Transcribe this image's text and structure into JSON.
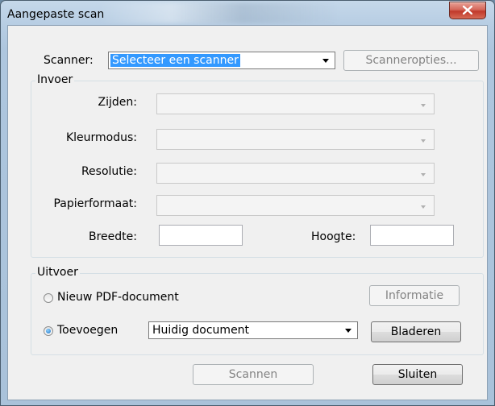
{
  "window": {
    "title": "Aangepaste scan",
    "close_icon": "close-icon"
  },
  "scanner": {
    "label": "Scanner:",
    "selected": "Selecteer een scanner",
    "options_button": "Scanneropties..."
  },
  "input_group": {
    "legend": "Invoer",
    "sides_label": "Zijden:",
    "color_mode_label": "Kleurmodus:",
    "resolution_label": "Resolutie:",
    "paper_size_label": "Papierformaat:",
    "width_label": "Breedte:",
    "height_label": "Hoogte:",
    "width_value": "",
    "height_value": ""
  },
  "output_group": {
    "legend": "Uitvoer",
    "new_pdf_label": "Nieuw PDF-document",
    "append_label": "Toevoegen",
    "append_target": "Huidig document",
    "info_button": "Informatie",
    "browse_button": "Bladeren",
    "selected_option": "Toevoegen"
  },
  "footer": {
    "scan_button": "Scannen",
    "close_button": "Sluiten"
  },
  "colors": {
    "selection": "#3399ff",
    "titlebar": "#b7cde3",
    "close_button": "#c0392b"
  }
}
